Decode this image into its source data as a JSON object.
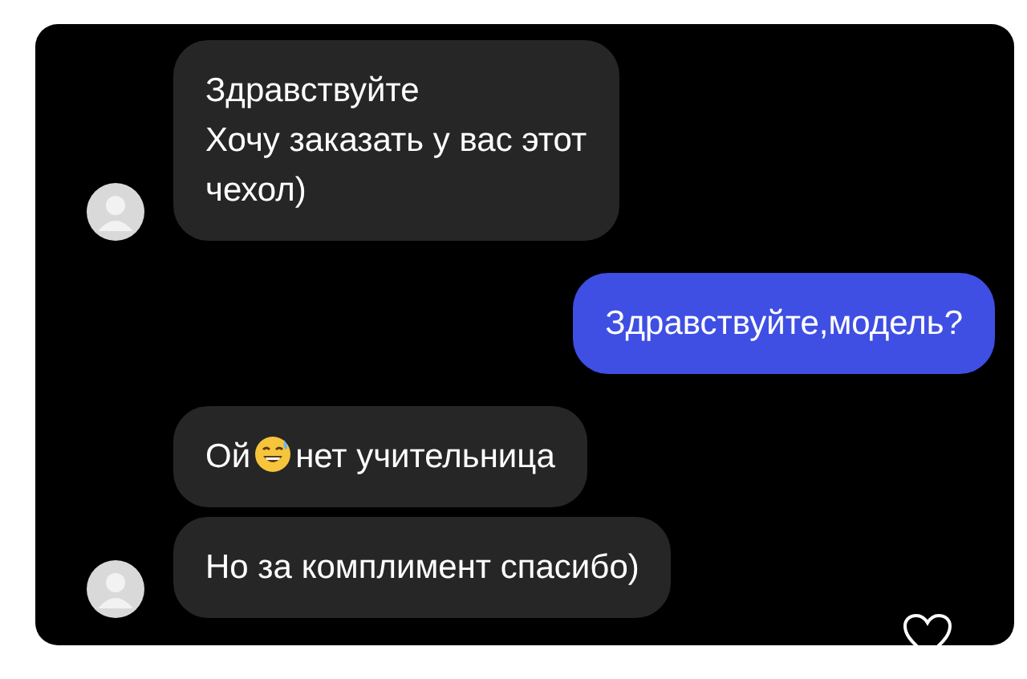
{
  "messages": [
    {
      "kind": "received",
      "avatar": true,
      "segments": [
        {
          "kind": "text",
          "text": "Здравствуйте"
        },
        {
          "kind": "break"
        },
        {
          "kind": "text",
          "text": "Хочу заказать у вас этот"
        },
        {
          "kind": "break"
        },
        {
          "kind": "text",
          "text": "чехол)"
        }
      ]
    },
    {
      "kind": "sent",
      "avatar": false,
      "segments": [
        {
          "kind": "text",
          "text": "Здравствуйте,модель?"
        }
      ]
    },
    {
      "kind": "received",
      "avatar": false,
      "segments": [
        {
          "kind": "text",
          "text": "Ой"
        },
        {
          "kind": "emoji"
        },
        {
          "kind": "text",
          "text": "нет учительница"
        }
      ]
    },
    {
      "kind": "received",
      "avatar": true,
      "segments": [
        {
          "kind": "text",
          "text": "Но за комплимент спасибо)"
        }
      ]
    }
  ]
}
